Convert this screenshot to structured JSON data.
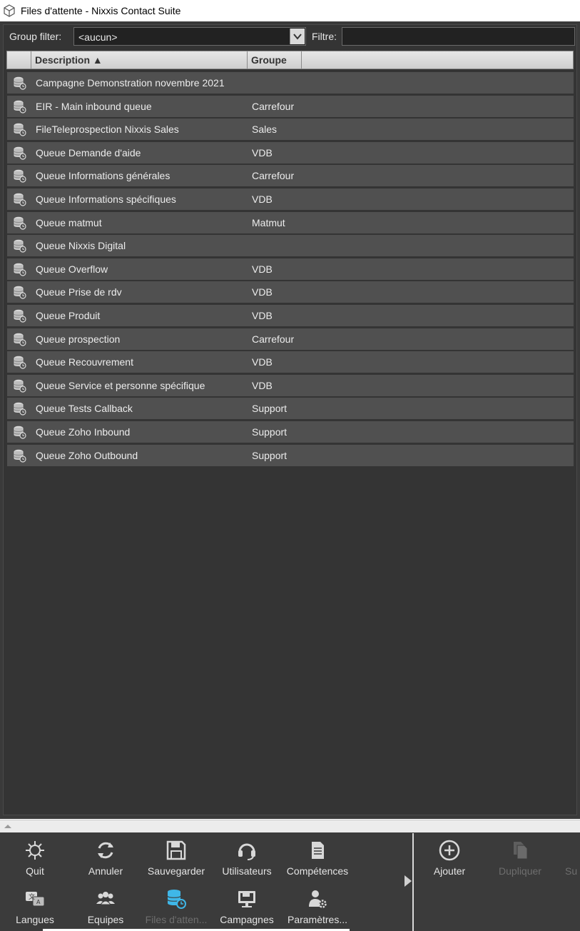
{
  "window": {
    "title": "Files d'attente - Nixxis Contact Suite",
    "icon": "cube-icon"
  },
  "filter": {
    "group_label": "Group filter:",
    "group_value": "<aucun>",
    "filter_label": "Filtre:",
    "filter_value": ""
  },
  "table": {
    "columns": [
      "Description ▲",
      "Groupe"
    ],
    "rows": [
      {
        "description": "Campagne Demonstration novembre 2021",
        "groupe": ""
      },
      {
        "description": "EIR - Main inbound queue",
        "groupe": "Carrefour"
      },
      {
        "description": "FileTeleprospection Nixxis Sales",
        "groupe": "Sales"
      },
      {
        "description": "Queue Demande d'aide",
        "groupe": "VDB"
      },
      {
        "description": "Queue Informations générales",
        "groupe": "Carrefour"
      },
      {
        "description": "Queue Informations spécifiques",
        "groupe": "VDB"
      },
      {
        "description": "Queue matmut",
        "groupe": "Matmut"
      },
      {
        "description": "Queue Nixxis Digital",
        "groupe": ""
      },
      {
        "description": "Queue Overflow",
        "groupe": "VDB"
      },
      {
        "description": "Queue Prise de rdv",
        "groupe": "VDB"
      },
      {
        "description": "Queue Produit",
        "groupe": "VDB"
      },
      {
        "description": "Queue prospection",
        "groupe": "Carrefour"
      },
      {
        "description": "Queue Recouvrement",
        "groupe": "VDB"
      },
      {
        "description": "Queue Service et personne spécifique",
        "groupe": "VDB"
      },
      {
        "description": "Queue Tests Callback",
        "groupe": "Support"
      },
      {
        "description": "Queue Zoho Inbound",
        "groupe": "Support"
      },
      {
        "description": "Queue Zoho Outbound",
        "groupe": "Support"
      }
    ]
  },
  "ribbon": {
    "nav": [
      {
        "label": "Quit",
        "icon": "quit-icon"
      },
      {
        "label": "Annuler",
        "icon": "refresh-icon"
      },
      {
        "label": "Sauvegarder",
        "icon": "save-icon"
      },
      {
        "label": "Utilisateurs",
        "icon": "headset-icon"
      },
      {
        "label": "Compétences",
        "icon": "document-icon"
      },
      {
        "label": "Langues",
        "icon": "language-icon"
      },
      {
        "label": "Equipes",
        "icon": "team-icon"
      },
      {
        "label": "Files d'atten...",
        "icon": "queue-icon"
      },
      {
        "label": "Campagnes",
        "icon": "monitor-icon"
      },
      {
        "label": "Paramètres...",
        "icon": "user-settings-icon"
      }
    ],
    "actions": [
      {
        "label": "Ajouter",
        "icon": "add-icon"
      },
      {
        "label": "Dupliquer",
        "icon": "duplicate-icon"
      },
      {
        "label": "Su",
        "icon": ""
      }
    ]
  },
  "colors": {
    "selected_icon": "#3fb7e8",
    "panel_bg": "#343434",
    "row_bg": "#505050"
  }
}
